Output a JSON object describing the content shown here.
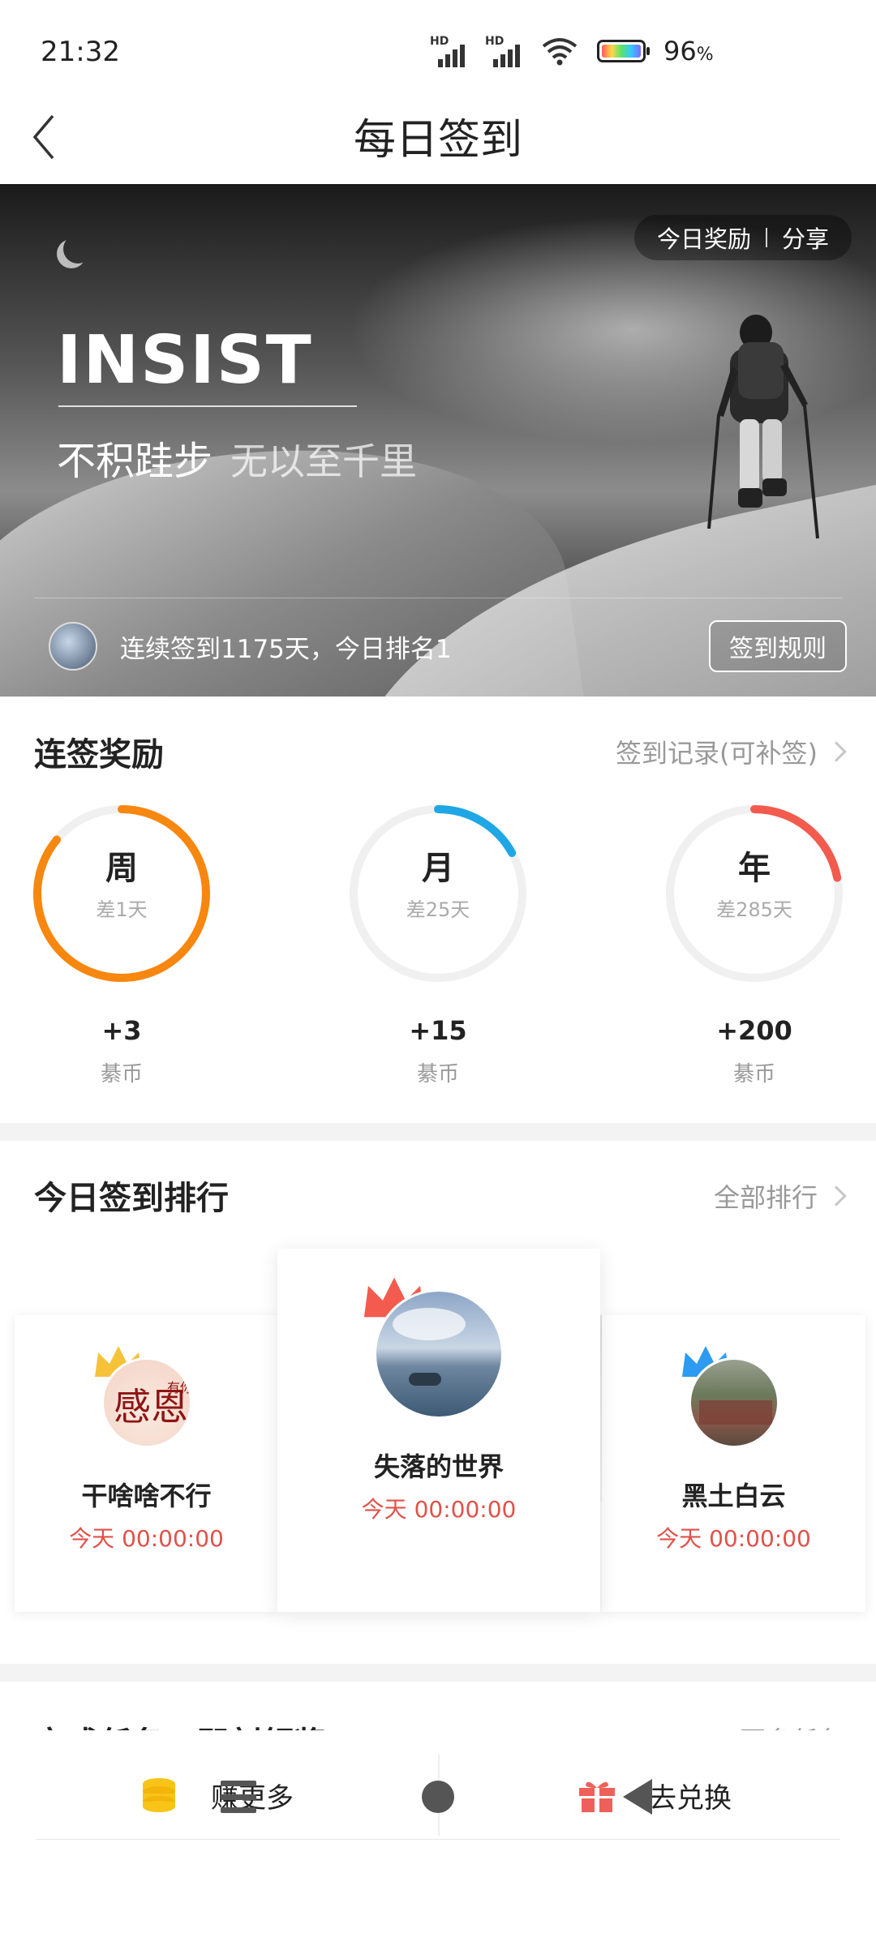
{
  "status_bar": {
    "time": "21:32",
    "signal1_label": "HD",
    "signal2_label": "HD",
    "battery_percent": "96",
    "battery_unit": "%"
  },
  "header": {
    "title": "每日签到"
  },
  "banner": {
    "reward_label": "今日奖励",
    "share_label": "分享",
    "headline": "INSIST",
    "motto_main": "不积跬步",
    "motto_sub": "无以至千里",
    "streak_text": "连续签到1175天，今日排名1",
    "rules_button": "签到规则"
  },
  "streak_rewards": {
    "title": "连签奖励",
    "record_link": "签到记录(可补签)",
    "items": [
      {
        "period": "周",
        "remaining": "差1天",
        "amount": "+3",
        "unit": "綦币",
        "progress": 0.86,
        "color": "#f7870f"
      },
      {
        "period": "月",
        "remaining": "差25天",
        "amount": "+15",
        "unit": "綦币",
        "progress": 0.17,
        "color": "#1ea7e4"
      },
      {
        "period": "年",
        "remaining": "差285天",
        "amount": "+200",
        "unit": "綦币",
        "progress": 0.22,
        "color": "#f25b4e"
      }
    ]
  },
  "ranking": {
    "title": "今日签到排行",
    "all_link": "全部排行",
    "users": [
      {
        "name": "干啥啥不行",
        "time": "今天 00:00:00",
        "rank_color": "#f5c23a"
      },
      {
        "name": "失落的世界",
        "time": "今天 00:00:00",
        "rank_color": "#f25b4e"
      },
      {
        "name": "黑土白云",
        "time": "今天 00:00:00",
        "rank_color": "#2d9bef"
      }
    ]
  },
  "tasks_preview": {
    "title": "完成任务，即刻领奖",
    "link": "更多任务"
  },
  "bottom_actions": {
    "earn_label": "赚更多",
    "redeem_label": "去兑换"
  },
  "colors": {
    "accent_red": "#e0524a",
    "coin_yellow": "#f8c417",
    "gift_red": "#f0605a"
  }
}
